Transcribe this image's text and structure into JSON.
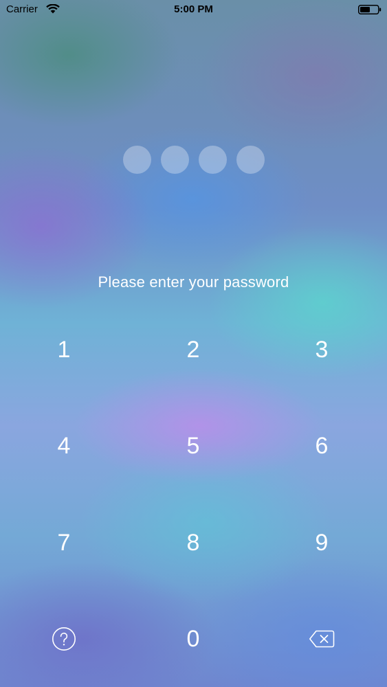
{
  "status_bar": {
    "carrier": "Carrier",
    "time": "5:00 PM",
    "wifi_icon": "wifi-icon",
    "battery_icon": "battery-icon"
  },
  "passcode": {
    "dot_count": 4,
    "prompt": "Please enter your password"
  },
  "keypad": {
    "keys": [
      "1",
      "2",
      "3",
      "4",
      "5",
      "6",
      "7",
      "8",
      "9",
      "0"
    ],
    "help_icon": "question-circle-icon",
    "delete_icon": "backspace-icon"
  },
  "colors": {
    "text": "#ffffff",
    "dot_fill": "rgba(255,255,255,0.3)",
    "status_text": "#000000"
  }
}
